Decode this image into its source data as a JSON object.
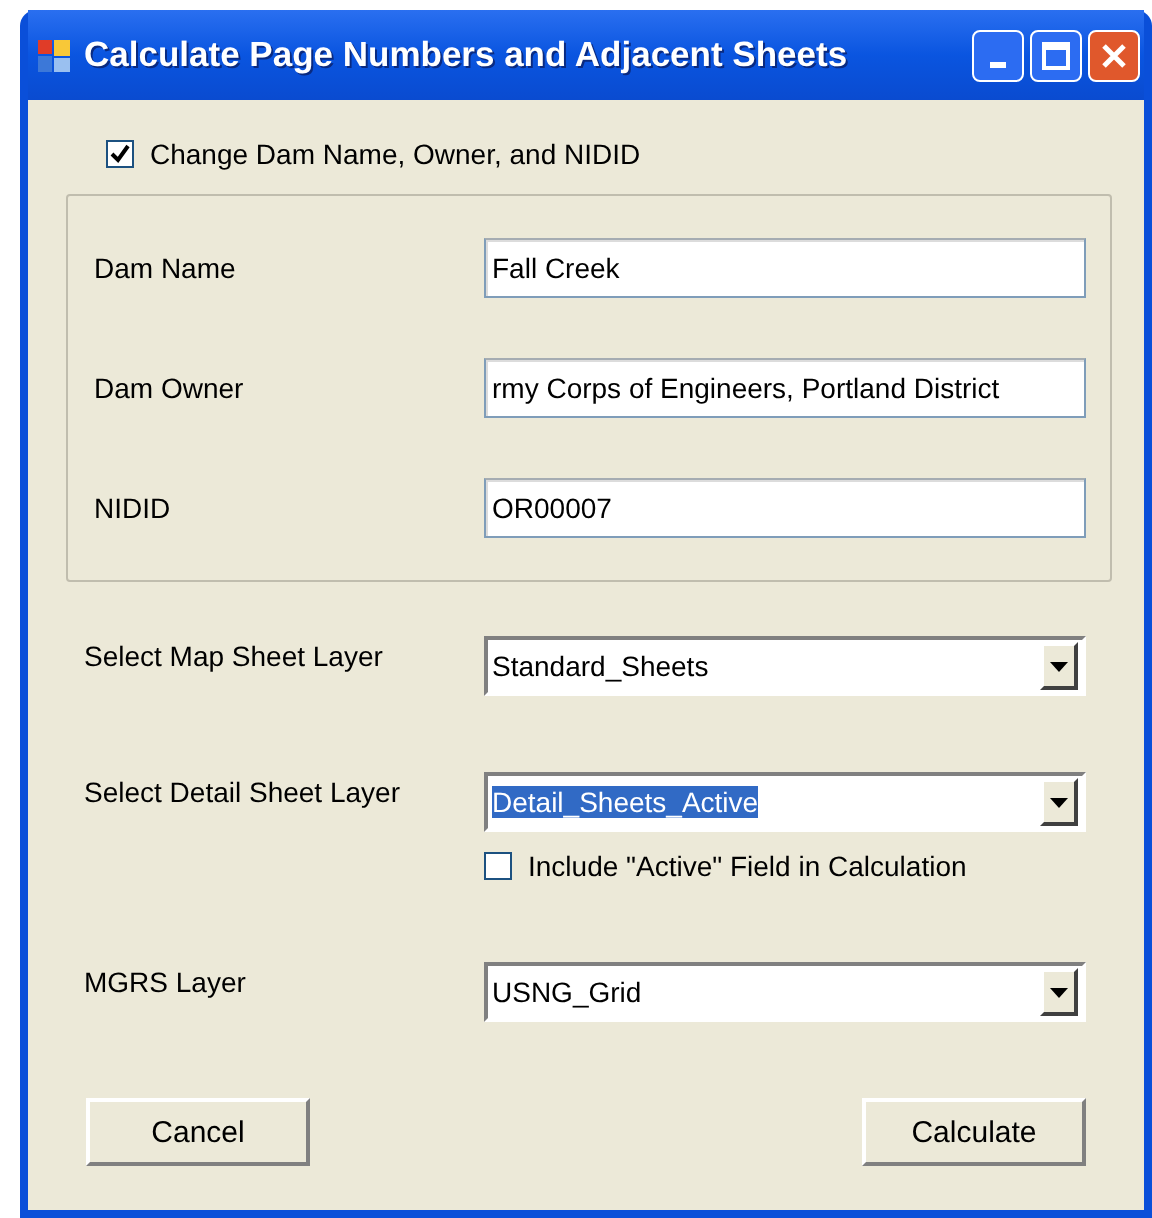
{
  "window": {
    "title": "Calculate Page Numbers and Adjacent Sheets"
  },
  "change_checkbox": {
    "label": "Change Dam Name, Owner, and NIDID",
    "checked": true
  },
  "dam_fields": [
    {
      "label": "Dam Name",
      "value": "Fall Creek"
    },
    {
      "label": "Dam Owner",
      "value": "rmy Corps of Engineers, Portland District"
    },
    {
      "label": "NIDID",
      "value": "OR00007"
    }
  ],
  "layers": [
    {
      "label": "Select Map Sheet Layer",
      "value": "Standard_Sheets",
      "highlighted": false
    },
    {
      "label": "Select Detail Sheet Layer",
      "value": "Detail_Sheets_Active",
      "highlighted": true,
      "option": {
        "label": "Include \"Active\" Field in Calculation",
        "checked": false
      }
    },
    {
      "label": "MGRS Layer",
      "value": "USNG_Grid",
      "highlighted": false
    }
  ],
  "buttons": [
    "Cancel",
    "Calculate"
  ]
}
